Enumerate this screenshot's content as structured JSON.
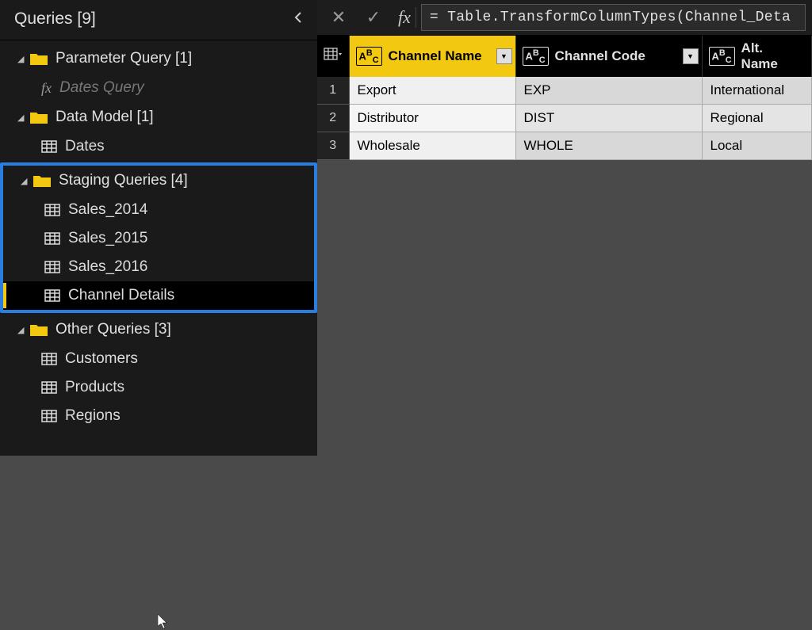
{
  "sidebar": {
    "title": "Queries [9]",
    "groups": [
      {
        "label": "Parameter Query [1]",
        "items": [
          {
            "label": "Dates Query",
            "type": "fx",
            "disabled": true
          }
        ]
      },
      {
        "label": "Data Model [1]",
        "items": [
          {
            "label": "Dates",
            "type": "table"
          }
        ]
      },
      {
        "label": "Staging Queries [4]",
        "highlighted": true,
        "items": [
          {
            "label": "Sales_2014",
            "type": "table"
          },
          {
            "label": "Sales_2015",
            "type": "table"
          },
          {
            "label": "Sales_2016",
            "type": "table"
          },
          {
            "label": "Channel Details",
            "type": "table",
            "selected": true
          }
        ]
      },
      {
        "label": "Other Queries [3]",
        "items": [
          {
            "label": "Customers",
            "type": "table"
          },
          {
            "label": "Products",
            "type": "table"
          },
          {
            "label": "Regions",
            "type": "table"
          }
        ]
      }
    ]
  },
  "formula_bar": {
    "cancel_icon": "✕",
    "confirm_icon": "✓",
    "fx_label": "fx",
    "value": "= Table.TransformColumnTypes(Channel_Deta"
  },
  "table": {
    "columns": [
      {
        "name": "Channel Name",
        "type": "ABC",
        "selected": true
      },
      {
        "name": "Channel Code",
        "type": "ABC"
      },
      {
        "name": "Alt. Name",
        "type": "ABC"
      }
    ],
    "rows": [
      {
        "num": "1",
        "cells": [
          "Export",
          "EXP",
          "International"
        ]
      },
      {
        "num": "2",
        "cells": [
          "Distributor",
          "DIST",
          "Regional"
        ]
      },
      {
        "num": "3",
        "cells": [
          "Wholesale",
          "WHOLE",
          "Local"
        ]
      }
    ]
  }
}
